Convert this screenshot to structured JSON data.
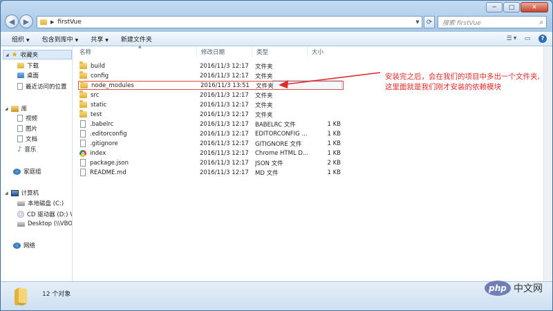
{
  "window": {
    "caption": {
      "minimize": "─",
      "maximize": "□",
      "close": "✕"
    }
  },
  "address": {
    "path": "firstVue",
    "refresh_icon": "refresh-icon",
    "search_placeholder": "搜索 firstVue"
  },
  "toolbar": {
    "organize": "组织",
    "include_library": "包含到库中",
    "share": "共享",
    "new_folder": "新建文件夹"
  },
  "nav": {
    "favorites": "收藏夹",
    "downloads": "下载",
    "desktop": "桌面",
    "recent": "最近访问的位置",
    "library": "库",
    "videos": "视频",
    "pictures": "图片",
    "documents": "文档",
    "music": "音乐",
    "homegroup": "家庭组",
    "computer": "计算机",
    "local_disk": "本地磁盘 (C:)",
    "cd_drive": "CD 驱动器 (D:) V",
    "desktop_share": "Desktop (\\\\VBO",
    "network": "网络"
  },
  "columns": {
    "name": "名称",
    "date": "修改日期",
    "type": "类型",
    "size": "大小"
  },
  "files": [
    {
      "name": "build",
      "date": "2016/11/3 12:17",
      "type": "文件夹",
      "size": "",
      "icon": "folder"
    },
    {
      "name": "config",
      "date": "2016/11/3 12:17",
      "type": "文件夹",
      "size": "",
      "icon": "folder"
    },
    {
      "name": "node_modules",
      "date": "2016/11/3 13:51",
      "type": "文件夹",
      "size": "",
      "icon": "folder"
    },
    {
      "name": "src",
      "date": "2016/11/3 12:17",
      "type": "文件夹",
      "size": "",
      "icon": "folder"
    },
    {
      "name": "static",
      "date": "2016/11/3 12:17",
      "type": "文件夹",
      "size": "",
      "icon": "folder"
    },
    {
      "name": "test",
      "date": "2016/11/3 12:17",
      "type": "文件夹",
      "size": "",
      "icon": "folder"
    },
    {
      "name": ".babelrc",
      "date": "2016/11/3 12:17",
      "type": "BABELRC 文件",
      "size": "1 KB",
      "icon": "file"
    },
    {
      "name": ".editorconfig",
      "date": "2016/11/3 12:17",
      "type": "EDITORCONFIG ...",
      "size": "1 KB",
      "icon": "file"
    },
    {
      "name": ".gitignore",
      "date": "2016/11/3 12:17",
      "type": "GITIGNORE 文件",
      "size": "1 KB",
      "icon": "file"
    },
    {
      "name": "index",
      "date": "2016/11/3 12:17",
      "type": "Chrome HTML D...",
      "size": "1 KB",
      "icon": "chrome"
    },
    {
      "name": "package.json",
      "date": "2016/11/3 12:17",
      "type": "JSON 文件",
      "size": "2 KB",
      "icon": "file"
    },
    {
      "name": "README.md",
      "date": "2016/11/3 12:17",
      "type": "MD 文件",
      "size": "1 KB",
      "icon": "file"
    }
  ],
  "annotation": {
    "line1": "安装完之后，会在我们的项目中多出一个文件夹,",
    "line2": "这里面就是我们刚才安装的依赖模块",
    "color": "#e12a2a"
  },
  "status": {
    "count": "12 个对象"
  },
  "watermark": {
    "logo": "php",
    "text": "中文网"
  }
}
